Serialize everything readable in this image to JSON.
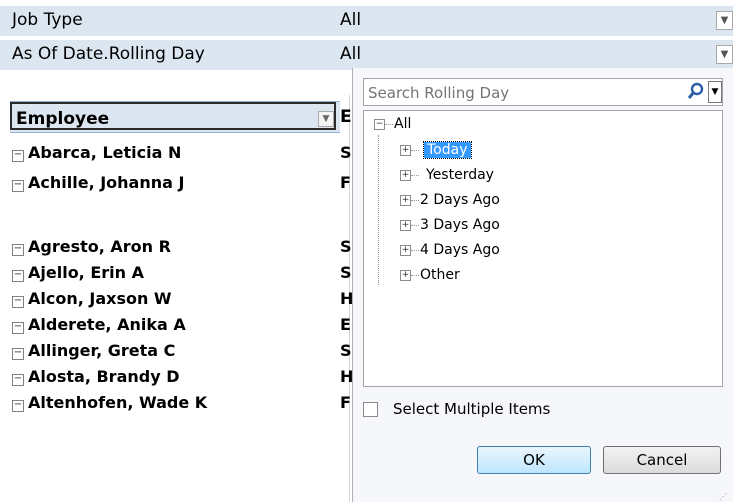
{
  "filters": [
    {
      "label": "Job Type",
      "value": "All"
    },
    {
      "label": "As Of Date.Rolling Day",
      "value": "All"
    }
  ],
  "pivot": {
    "header_label": "Employee",
    "next_header": "E",
    "rows": [
      {
        "name": "Abarca, Leticia N",
        "next": "S"
      },
      {
        "name": "Achille, Johanna J",
        "next": "F"
      },
      {
        "name": "Agresto, Aron R",
        "next": "S"
      },
      {
        "name": "Ajello, Erin A",
        "next": "S"
      },
      {
        "name": "Alcon, Jaxson W",
        "next": "H"
      },
      {
        "name": "Alderete, Anika A",
        "next": "E"
      },
      {
        "name": "Allinger, Greta C",
        "next": "S"
      },
      {
        "name": "Alosta, Brandy D",
        "next": "H"
      },
      {
        "name": "Altenhofen, Wade K",
        "next": "F"
      }
    ]
  },
  "popup": {
    "search_placeholder": "Search Rolling Day",
    "tree": {
      "root": "All",
      "children": [
        "Today",
        "Yesterday",
        "2 Days Ago",
        "3 Days Ago",
        "4 Days Ago",
        "Other"
      ],
      "selected": "Today"
    },
    "multi_label": "Select Multiple Items",
    "ok_label": "OK",
    "cancel_label": "Cancel"
  }
}
